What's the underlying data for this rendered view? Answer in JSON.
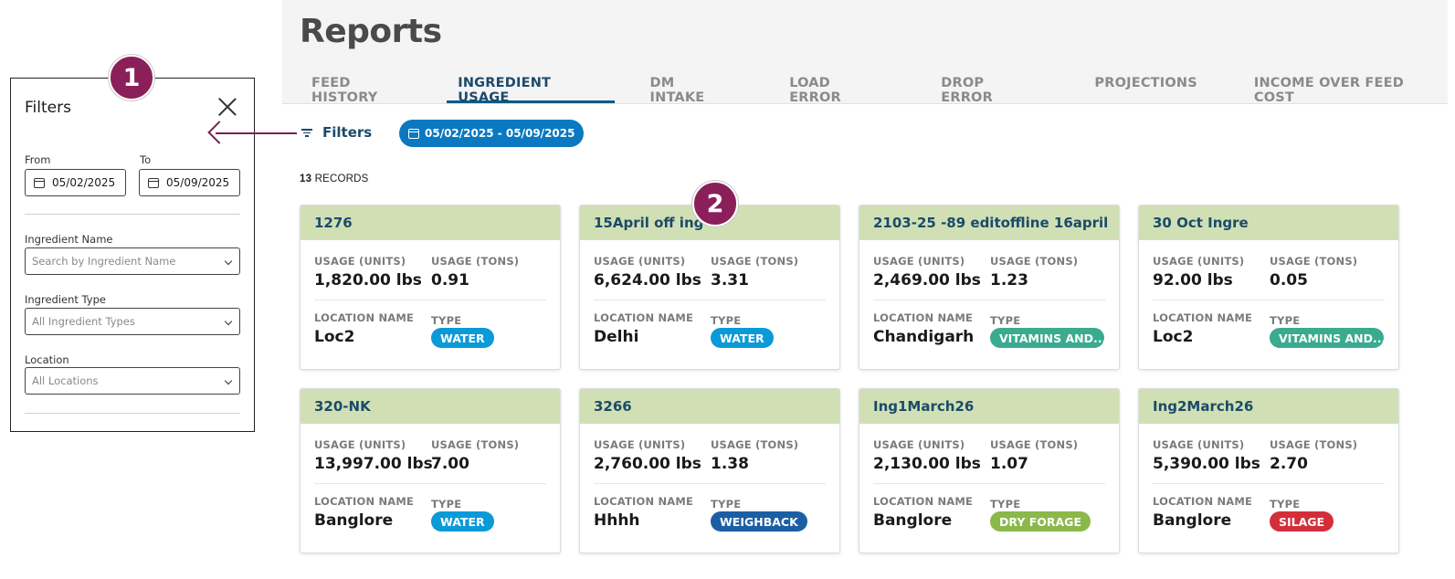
{
  "page": {
    "title": "Reports"
  },
  "tabs": [
    {
      "label": "FEED HISTORY",
      "active": false
    },
    {
      "label": "INGREDIENT USAGE",
      "active": true
    },
    {
      "label": "DM INTAKE",
      "active": false
    },
    {
      "label": "LOAD ERROR",
      "active": false
    },
    {
      "label": "DROP ERROR",
      "active": false
    },
    {
      "label": "PROJECTIONS",
      "active": false
    },
    {
      "label": "INCOME OVER FEED COST",
      "active": false
    }
  ],
  "toolbar": {
    "filters_label": "Filters",
    "date_range": "05/02/2025 - 05/09/2025",
    "filter_icon": "filter-lines-icon",
    "calendar_icon": "calendar-icon"
  },
  "records": {
    "count": "13",
    "label": "RECORDS"
  },
  "card_labels": {
    "usage_units": "USAGE (UNITS)",
    "usage_tons": "USAGE (TONS)",
    "location": "LOCATION NAME",
    "type": "TYPE"
  },
  "type_colors": {
    "WATER": "#0b9ad8",
    "VITAMINS AND...": "#3aab8e",
    "WEIGHBACK": "#1b5ea4",
    "DRY FORAGE": "#8ab84a",
    "SILAGE": "#d32f3a"
  },
  "cards": [
    {
      "name": "1276",
      "usage_units": "1,820.00 lbs",
      "usage_tons": "0.91",
      "location": "Loc2",
      "type": "WATER"
    },
    {
      "name": "15April off ing",
      "usage_units": "6,624.00 lbs",
      "usage_tons": "3.31",
      "location": "Delhi",
      "type": "WATER"
    },
    {
      "name": "2103-25 -89 editoffline 16april",
      "usage_units": "2,469.00 lbs",
      "usage_tons": "1.23",
      "location": "Chandigarh",
      "type": "VITAMINS AND..."
    },
    {
      "name": "30 Oct Ingre",
      "usage_units": "92.00 lbs",
      "usage_tons": "0.05",
      "location": "Loc2",
      "type": "VITAMINS AND..."
    },
    {
      "name": "320-NK",
      "usage_units": "13,997.00 lbs",
      "usage_tons": "7.00",
      "location": "Banglore",
      "type": "WATER"
    },
    {
      "name": "3266",
      "usage_units": "2,760.00 lbs",
      "usage_tons": "1.38",
      "location": "Hhhh",
      "type": "WEIGHBACK"
    },
    {
      "name": "Ing1March26",
      "usage_units": "2,130.00 lbs",
      "usage_tons": "1.07",
      "location": "Banglore",
      "type": "DRY FORAGE"
    },
    {
      "name": "Ing2March26",
      "usage_units": "5,390.00 lbs",
      "usage_tons": "2.70",
      "location": "Banglore",
      "type": "SILAGE"
    }
  ],
  "filter_panel": {
    "title": "Filters",
    "from_label": "From",
    "to_label": "To",
    "from_value": "05/02/2025",
    "to_value": "05/09/2025",
    "ingredient_name_label": "Ingredient Name",
    "ingredient_name_placeholder": "Search by Ingredient Name",
    "ingredient_type_label": "Ingredient Type",
    "ingredient_type_value": "All Ingredient Types",
    "location_label": "Location",
    "location_value": "All Locations"
  },
  "callouts": {
    "one": "1",
    "two": "2",
    "marker_color": "#8b1f5a"
  }
}
